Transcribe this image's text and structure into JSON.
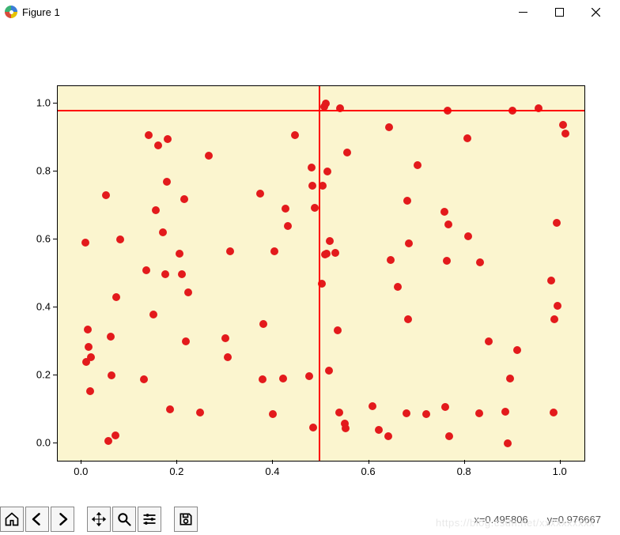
{
  "window": {
    "title": "Figure 1"
  },
  "toolbar": {
    "home_tip": "Reset original view",
    "back_tip": "Back to previous view",
    "forward_tip": "Forward to next view",
    "pan_tip": "Pan axes",
    "zoom_tip": "Zoom to rectangle",
    "subplots_tip": "Configure subplots",
    "save_tip": "Save the figure"
  },
  "status": {
    "x_label": "x=0.495806",
    "y_label": "y=0.976667"
  },
  "watermark": "https://blog.csdn.net/xxxxxxxxxx",
  "chart_data": {
    "type": "scatter",
    "title": "",
    "xlabel": "",
    "ylabel": "",
    "xlim": [
      -0.05,
      1.05
    ],
    "ylim": [
      -0.05,
      1.05
    ],
    "xticks": [
      0.0,
      0.2,
      0.4,
      0.6,
      0.8,
      1.0
    ],
    "yticks": [
      0.0,
      0.2,
      0.4,
      0.6,
      0.8,
      1.0
    ],
    "xticklabels": [
      "0.0",
      "0.2",
      "0.4",
      "0.6",
      "0.8",
      "1.0"
    ],
    "yticklabels": [
      "0.0",
      "0.2",
      "0.4",
      "0.6",
      "0.8",
      "1.0"
    ],
    "background": "#fbf5cf",
    "marker_color": "#e31a1c",
    "marker_size": 10,
    "crosshair": {
      "x": 0.496,
      "y": 0.977,
      "color": "#ff0000"
    },
    "x": [
      0.007,
      0.01,
      0.013,
      0.015,
      0.017,
      0.02,
      0.05,
      0.055,
      0.06,
      0.063,
      0.07,
      0.072,
      0.08,
      0.13,
      0.135,
      0.14,
      0.15,
      0.155,
      0.16,
      0.17,
      0.175,
      0.178,
      0.18,
      0.185,
      0.205,
      0.21,
      0.215,
      0.218,
      0.222,
      0.248,
      0.265,
      0.3,
      0.305,
      0.31,
      0.373,
      0.378,
      0.38,
      0.4,
      0.403,
      0.42,
      0.425,
      0.43,
      0.445,
      0.475,
      0.48,
      0.482,
      0.484,
      0.486,
      0.502,
      0.504,
      0.506,
      0.508,
      0.51,
      0.512,
      0.514,
      0.516,
      0.518,
      0.53,
      0.535,
      0.538,
      0.54,
      0.55,
      0.552,
      0.555,
      0.608,
      0.62,
      0.64,
      0.642,
      0.645,
      0.66,
      0.678,
      0.68,
      0.682,
      0.684,
      0.702,
      0.72,
      0.758,
      0.76,
      0.762,
      0.764,
      0.766,
      0.768,
      0.805,
      0.808,
      0.83,
      0.832,
      0.85,
      0.885,
      0.89,
      0.895,
      0.9,
      0.91,
      0.955,
      0.98,
      0.985,
      0.988,
      0.992,
      0.994,
      1.005,
      1.01
    ],
    "y": [
      0.59,
      0.24,
      0.335,
      0.285,
      0.155,
      0.255,
      0.73,
      0.007,
      0.315,
      0.2,
      0.025,
      0.43,
      0.6,
      0.19,
      0.51,
      0.905,
      0.38,
      0.685,
      0.875,
      0.62,
      0.498,
      0.77,
      0.895,
      0.1,
      0.557,
      0.498,
      0.718,
      0.3,
      0.445,
      0.092,
      0.845,
      0.31,
      0.255,
      0.565,
      0.735,
      0.19,
      0.352,
      0.088,
      0.564,
      0.192,
      0.69,
      0.64,
      0.905,
      0.198,
      0.81,
      0.758,
      0.048,
      0.692,
      0.47,
      0.758,
      0.99,
      0.555,
      1.0,
      0.558,
      0.8,
      0.215,
      0.596,
      0.56,
      0.332,
      0.092,
      0.985,
      0.058,
      0.046,
      0.854,
      0.11,
      0.04,
      0.022,
      0.93,
      0.54,
      0.46,
      0.09,
      0.714,
      0.365,
      0.588,
      0.818,
      0.088,
      0.68,
      0.108,
      0.536,
      0.979,
      0.643,
      0.023,
      0.897,
      0.61,
      0.09,
      0.532,
      0.3,
      0.095,
      0.0,
      0.192,
      0.977,
      0.275,
      0.985,
      0.478,
      0.092,
      0.365,
      0.648,
      0.405,
      0.936,
      0.91
    ]
  }
}
